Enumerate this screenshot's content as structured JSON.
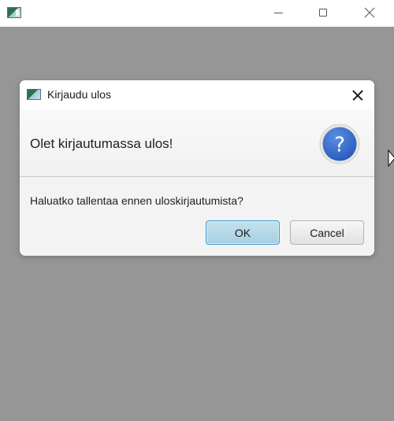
{
  "window": {
    "title": "",
    "background_color": "#969696",
    "controls": {
      "minimize_icon": "minimize-icon",
      "maximize_icon": "maximize-icon",
      "close_icon": "close-icon"
    }
  },
  "dialog": {
    "title": "Kirjaudu ulos",
    "header_text": "Olet kirjautumassa ulos!",
    "content_text": "Haluatko tallentaa ennen uloskirjautumista?",
    "icon": "question-icon",
    "icon_glyph": "?",
    "buttons": {
      "ok_label": "OK",
      "cancel_label": "Cancel"
    },
    "accent_color": "#3f9ad3"
  }
}
